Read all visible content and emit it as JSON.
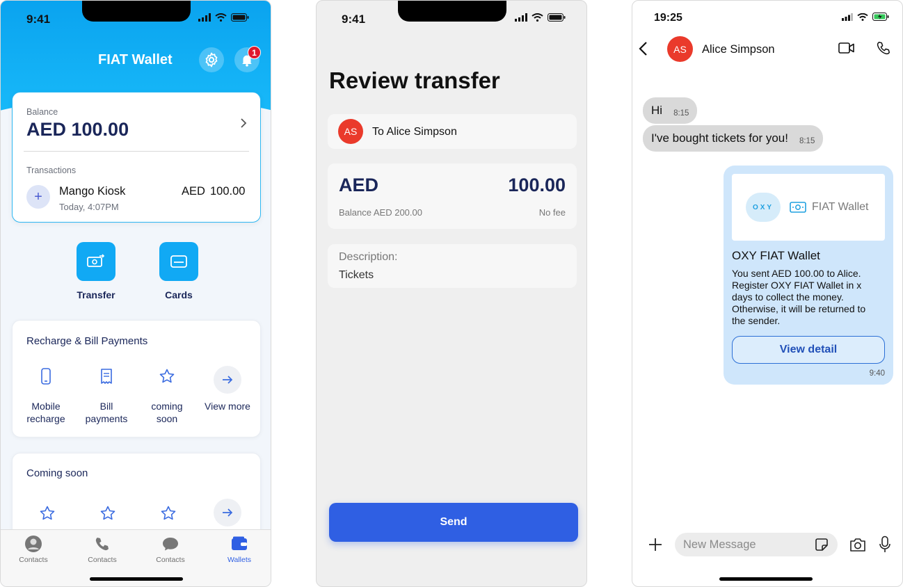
{
  "wallet": {
    "status_time": "9:41",
    "title": "FIAT Wallet",
    "notifications_count": "1",
    "balance_label": "Balance",
    "balance_value": "AED 100.00",
    "transactions_label": "Transactions",
    "tx_merchant": "Mango Kiosk",
    "tx_time": "Today, 4:07PM",
    "tx_currency": "AED",
    "tx_amount": "100.00",
    "actions": {
      "transfer": "Transfer",
      "cards": "Cards"
    },
    "recharge_title": "Recharge & Bill Payments",
    "services": {
      "mobile_1": "Mobile",
      "mobile_2": "recharge",
      "bill_1": "Bill",
      "bill_2": "payments",
      "soon_1": "coming",
      "soon_2": "soon",
      "more": "View more"
    },
    "coming_soon_title": "Coming soon",
    "tabs": {
      "t1": "Contacts",
      "t2": "Contacts",
      "t3": "Contacts",
      "t4": "Wallets"
    },
    "colors": {
      "brand": "#11a9f4",
      "navy": "#1a2659",
      "active_tab": "#2f5fe3"
    }
  },
  "review": {
    "status_time": "9:41",
    "title": "Review transfer",
    "recipient_initials": "AS",
    "recipient_label": "To Alice Simpson",
    "currency": "AED",
    "amount": "100.00",
    "balance_note": "Balance AED 200.00",
    "fee_note": "No fee",
    "description_label": "Description:",
    "description_value": "Tickets",
    "send_label": "Send"
  },
  "chat": {
    "status_time": "19:25",
    "contact_initials": "AS",
    "contact_name": "Alice Simpson",
    "messages": {
      "m1_text": "Hi",
      "m1_time": "8:15",
      "m2_text": "I've bought tickets for you!",
      "m2_time": "8:15"
    },
    "card": {
      "logo_text": "OXY",
      "brand_text": "FIAT Wallet",
      "title": "OXY FIAT Wallet",
      "line1": "You sent AED 100.00 to Alice.",
      "line2": "Register OXY FIAT Wallet in x",
      "line3": "days to collect the money.",
      "line4": "Otherwise, it will be returned to",
      "line5": "the sender.",
      "button": "View detail",
      "time": "9:40"
    },
    "input_placeholder": "New Message"
  }
}
